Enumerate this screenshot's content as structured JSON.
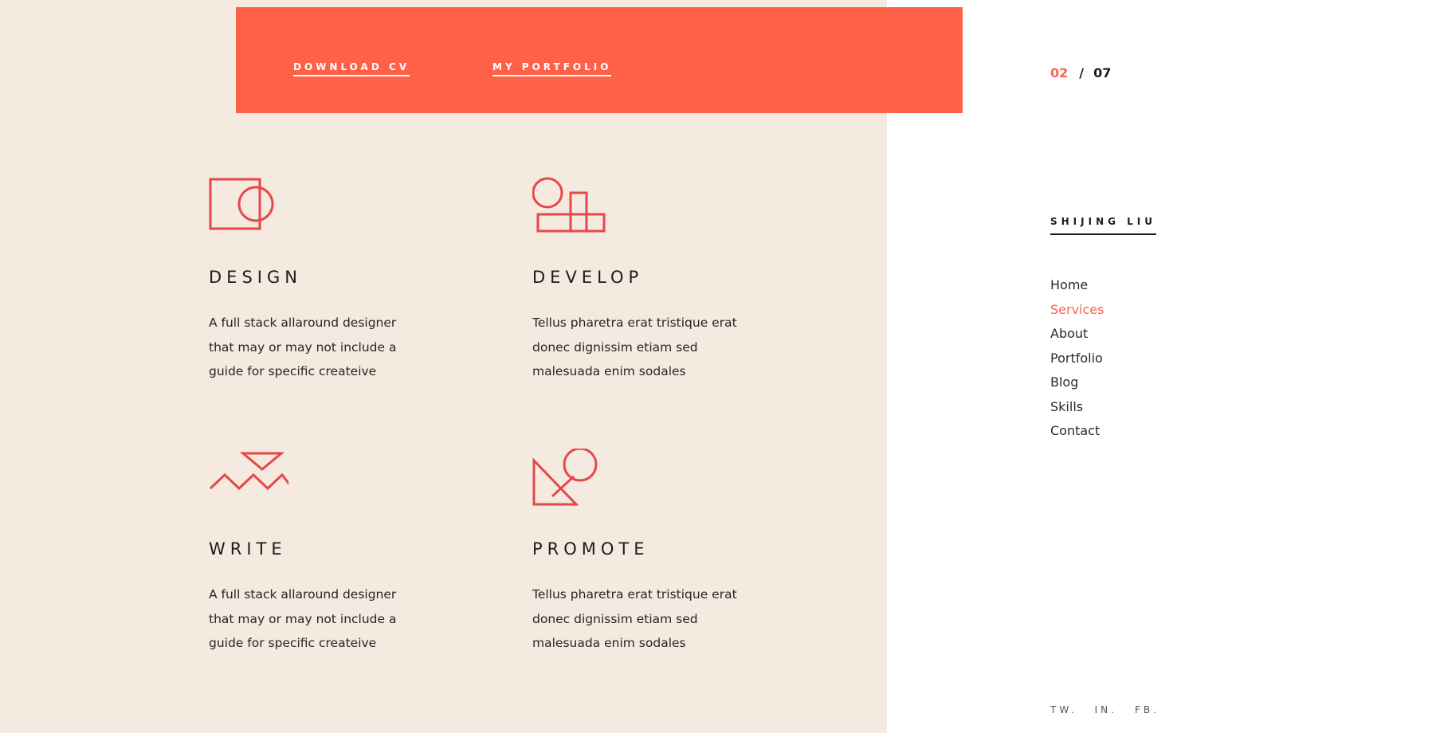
{
  "cta": {
    "download_cv": "DOWNLOAD CV",
    "my_portfolio": "MY PORTFOLIO"
  },
  "services": [
    {
      "title": "DESIGN",
      "text": "A full stack allaround designer that may or may not include a guide for specific createive",
      "icon": "square-circle-icon"
    },
    {
      "title": "DEVELOP",
      "text": "Tellus pharetra erat tristique erat donec dignissim etiam sed malesuada enim sodales",
      "icon": "circle-blocks-icon"
    },
    {
      "title": "WRITE",
      "text": "A full stack allaround designer that may or may not include a guide for specific createive",
      "icon": "triangle-zigzag-icon"
    },
    {
      "title": "PROMOTE",
      "text": "Tellus pharetra erat tristique erat donec dignissim etiam sed malesuada enim sodales",
      "icon": "triangle-circle-icon"
    }
  ],
  "counter": {
    "current": "02",
    "separator": "/",
    "total": "07"
  },
  "brand": "SHIJING LIU",
  "nav": [
    "Home",
    "Services",
    "About",
    "Portfolio",
    "Blog",
    "Skills",
    "Contact"
  ],
  "nav_active": "Services",
  "social": [
    "TW.",
    "IN.",
    "FB."
  ],
  "colors": {
    "accent": "#ff6148",
    "icon": "#e8474a",
    "panel": "#f4eadf"
  }
}
